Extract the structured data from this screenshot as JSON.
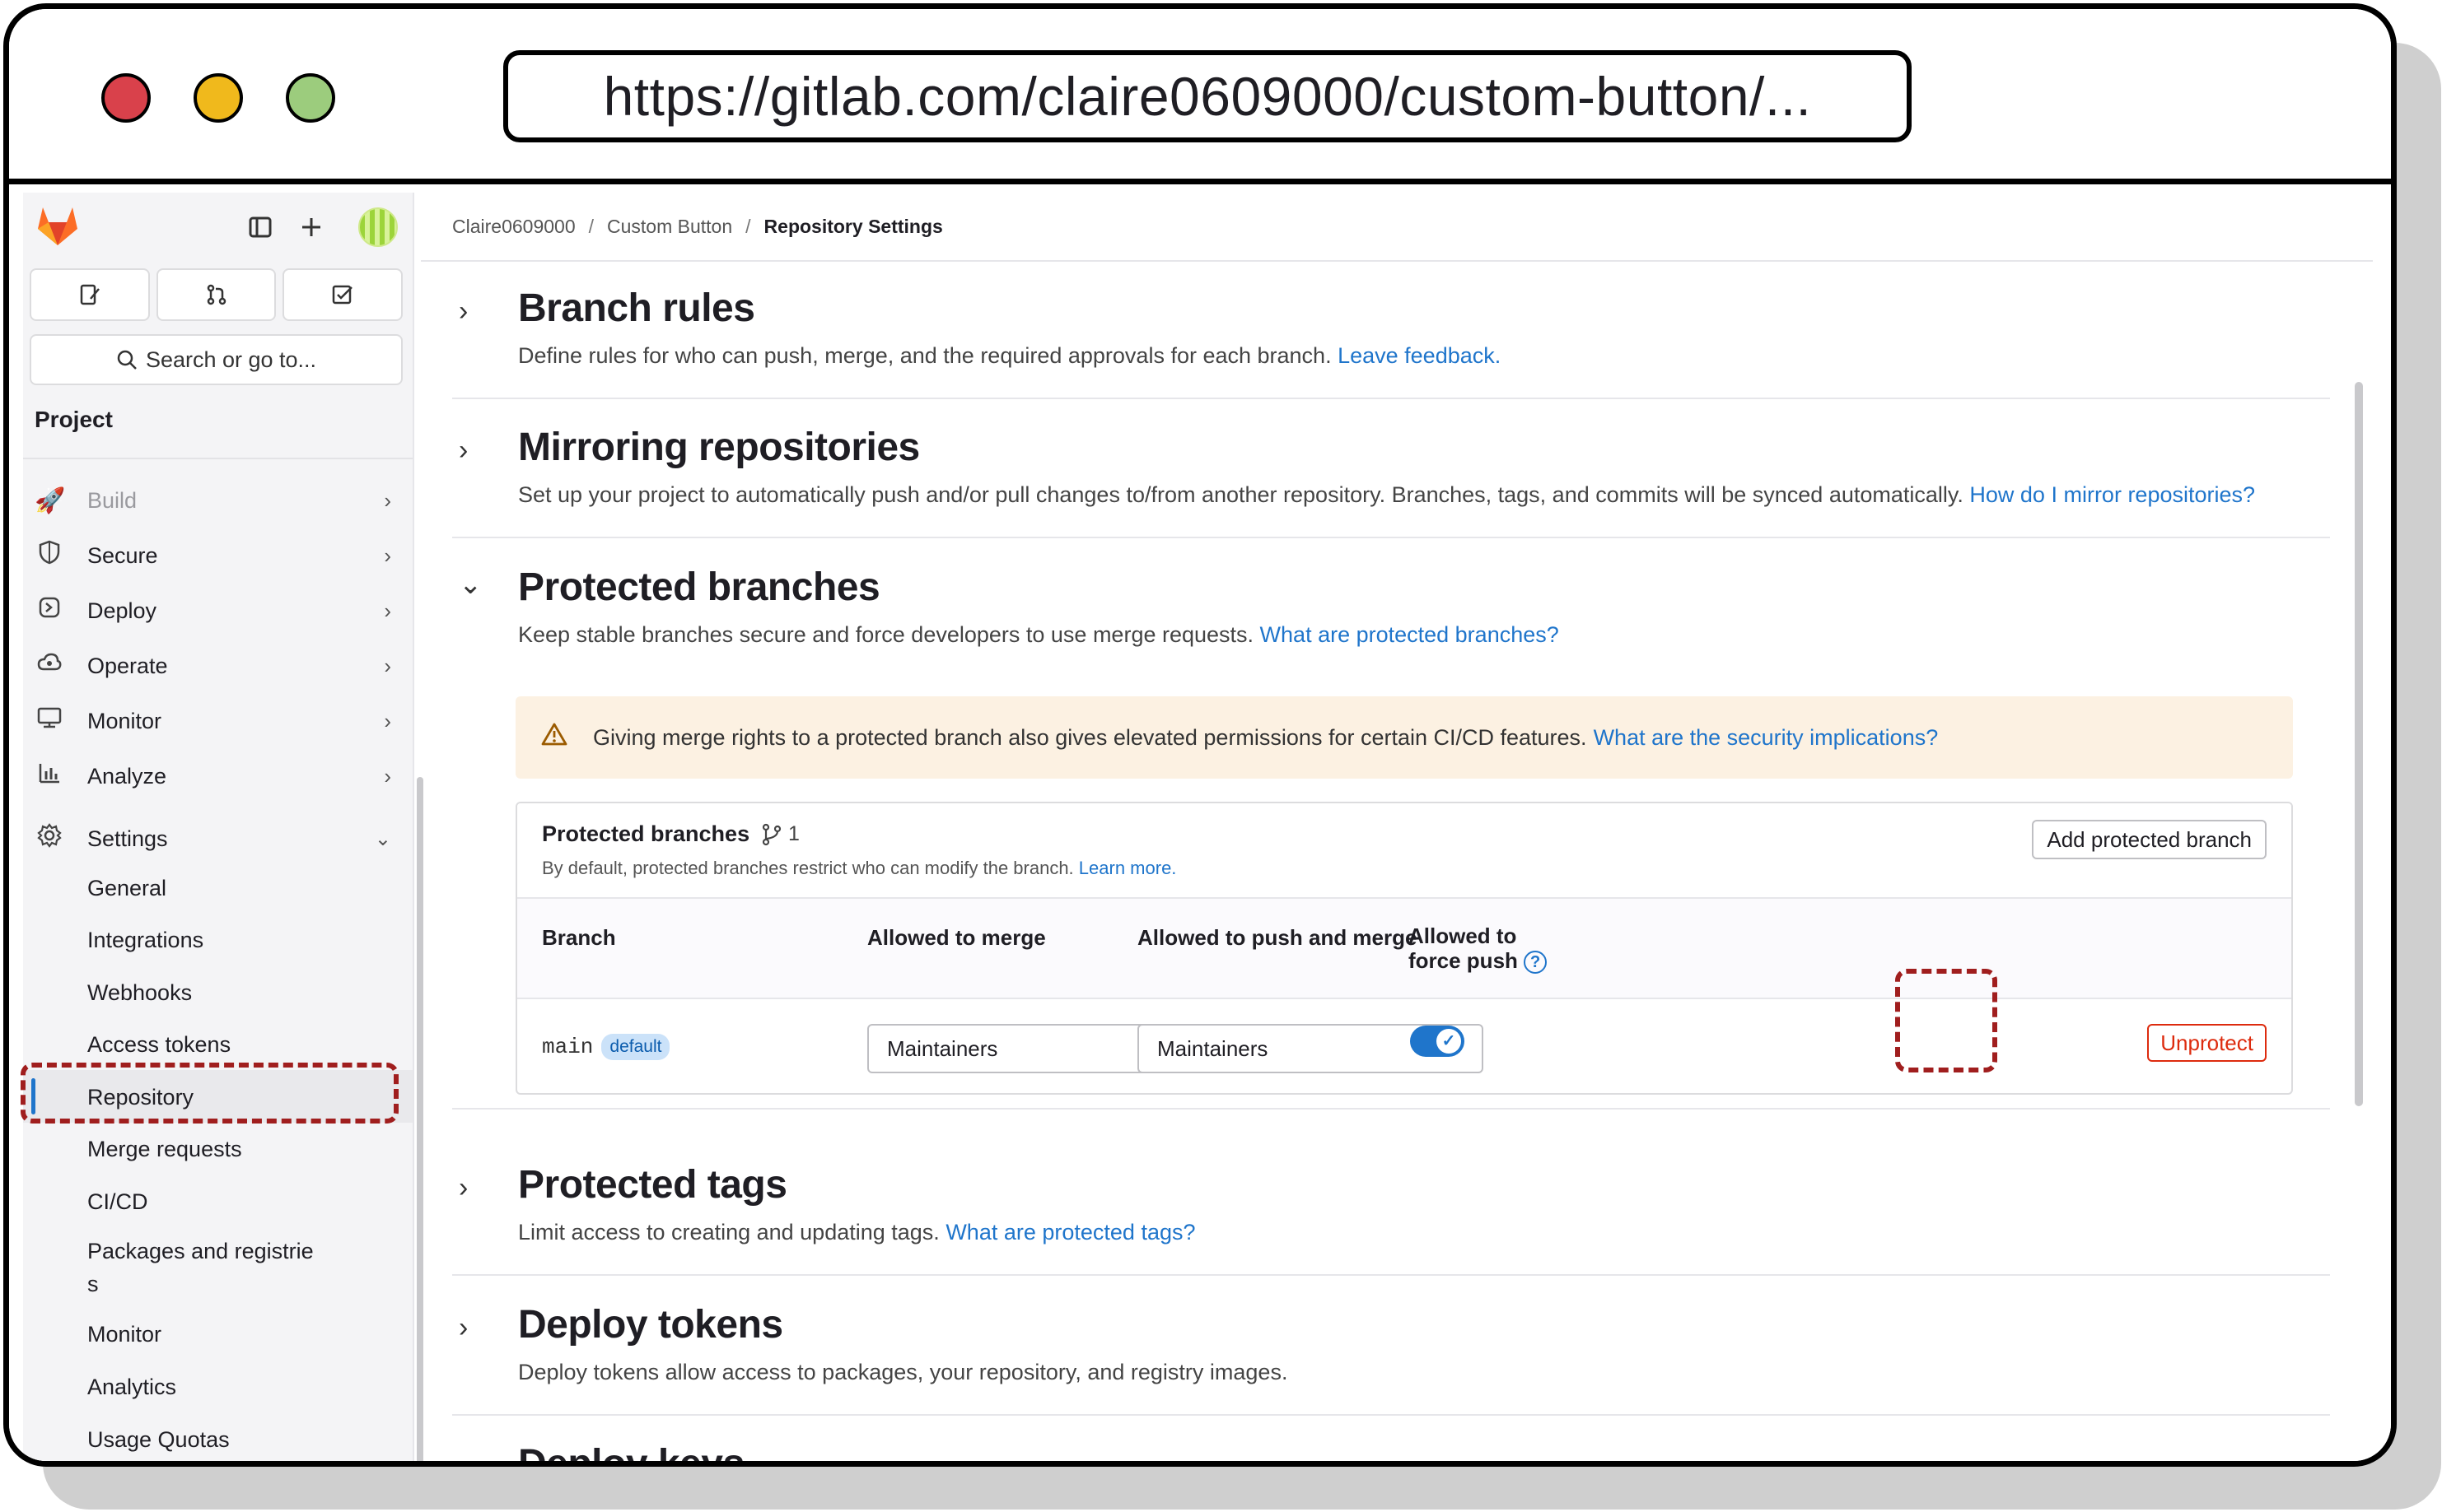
{
  "browser": {
    "url": "https://gitlab.com/claire0609000/custom-button/..."
  },
  "sidebar": {
    "search_label": "Search or go to...",
    "section_title": "Project",
    "items": [
      {
        "label": "Build",
        "icon": "rocket-icon"
      },
      {
        "label": "Secure",
        "icon": "shield-icon"
      },
      {
        "label": "Deploy",
        "icon": "deploy-icon"
      },
      {
        "label": "Operate",
        "icon": "cloud-icon"
      },
      {
        "label": "Monitor",
        "icon": "monitor-icon"
      },
      {
        "label": "Analyze",
        "icon": "chart-icon"
      },
      {
        "label": "Settings",
        "icon": "gear-icon"
      }
    ],
    "settings_sub": [
      "General",
      "Integrations",
      "Webhooks",
      "Access tokens",
      "Repository",
      "Merge requests",
      "CI/CD",
      "Packages and registrie",
      "s",
      "Monitor",
      "Analytics",
      "Usage Quotas"
    ]
  },
  "breadcrumb": {
    "items": [
      "Claire0609000",
      "Custom Button",
      "Repository Settings"
    ]
  },
  "sections": {
    "branch_rules": {
      "title": "Branch rules",
      "desc": "Define rules for who can push, merge, and the required approvals for each branch.",
      "link": "Leave feedback."
    },
    "mirroring": {
      "title": "Mirroring repositories",
      "desc": "Set up your project to automatically push and/or pull changes to/from another repository. Branches, tags, and commits will be synced automatically.",
      "link": "How do I mirror repositories?"
    },
    "protected_branches": {
      "title": "Protected branches",
      "desc": "Keep stable branches secure and force developers to use merge requests.",
      "link": "What are protected branches?"
    },
    "protected_tags": {
      "title": "Protected tags",
      "desc": "Limit access to creating and updating tags.",
      "link": "What are protected tags?"
    },
    "deploy_tokens": {
      "title": "Deploy tokens",
      "desc": "Deploy tokens allow access to packages, your repository, and registry images."
    },
    "deploy_keys": {
      "title": "Deploy keys"
    }
  },
  "alert": {
    "text": "Giving merge rights to a protected branch also gives elevated permissions for certain CI/CD features.",
    "link": "What are the security implications?"
  },
  "card": {
    "title": "Protected branches",
    "count": "1",
    "subtitle": "By default, protected branches restrict who can modify the branch.",
    "subtitle_link": "Learn more.",
    "add_button": "Add protected branch",
    "columns": {
      "branch": "Branch",
      "merge": "Allowed to merge",
      "push_merge": "Allowed to push and merge",
      "force_push_line1": "Allowed to",
      "force_push_line2": "force push"
    },
    "rows": [
      {
        "branch": "main",
        "badge": "default",
        "merge": "Maintainers",
        "push_merge": "Maintainers",
        "force_push": true,
        "action": "Unprotect"
      }
    ]
  }
}
